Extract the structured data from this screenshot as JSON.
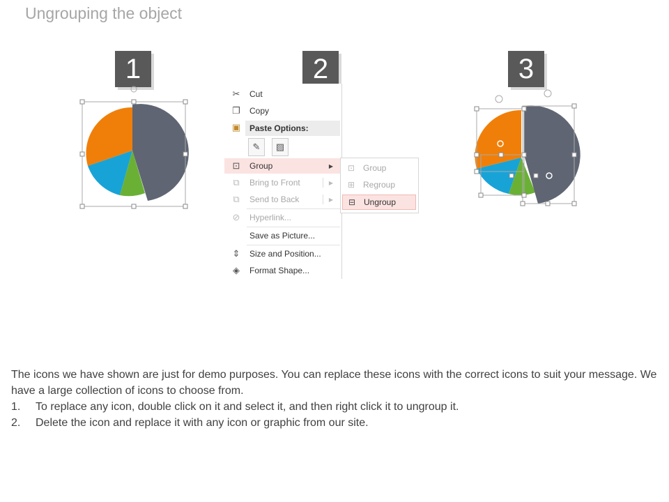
{
  "slide": {
    "title": "Ungrouping the object",
    "steps": [
      "1",
      "2",
      "3"
    ]
  },
  "colors": {
    "orange": "#f07f09",
    "slate": "#5f6573",
    "blue": "#18a3d7",
    "green": "#6ab035",
    "badge": "#595959",
    "highlight": "#fbe3e1"
  },
  "context_menu": {
    "cut": "Cut",
    "copy": "Copy",
    "paste_options": "Paste Options:",
    "group": "Group",
    "bring_to_front": "Bring to Front",
    "send_to_back": "Send to Back",
    "hyperlink": "Hyperlink...",
    "save_as_picture": "Save as Picture...",
    "size_and_position": "Size and Position...",
    "format_shape": "Format Shape..."
  },
  "submenu": {
    "group": "Group",
    "regroup": "Regroup",
    "ungroup": "Ungroup"
  },
  "body": {
    "paragraph": "The icons we have shown are just for demo purposes. You can replace these icons with the correct icons to suit your message. We have a large collection of icons to choose from.",
    "items": [
      {
        "num": "1.",
        "text": "To replace any icon, double click on it and select it, and then right click it to ungroup it."
      },
      {
        "num": "2.",
        "text": "Delete the icon and replace it with any icon or graphic from our site."
      }
    ]
  }
}
